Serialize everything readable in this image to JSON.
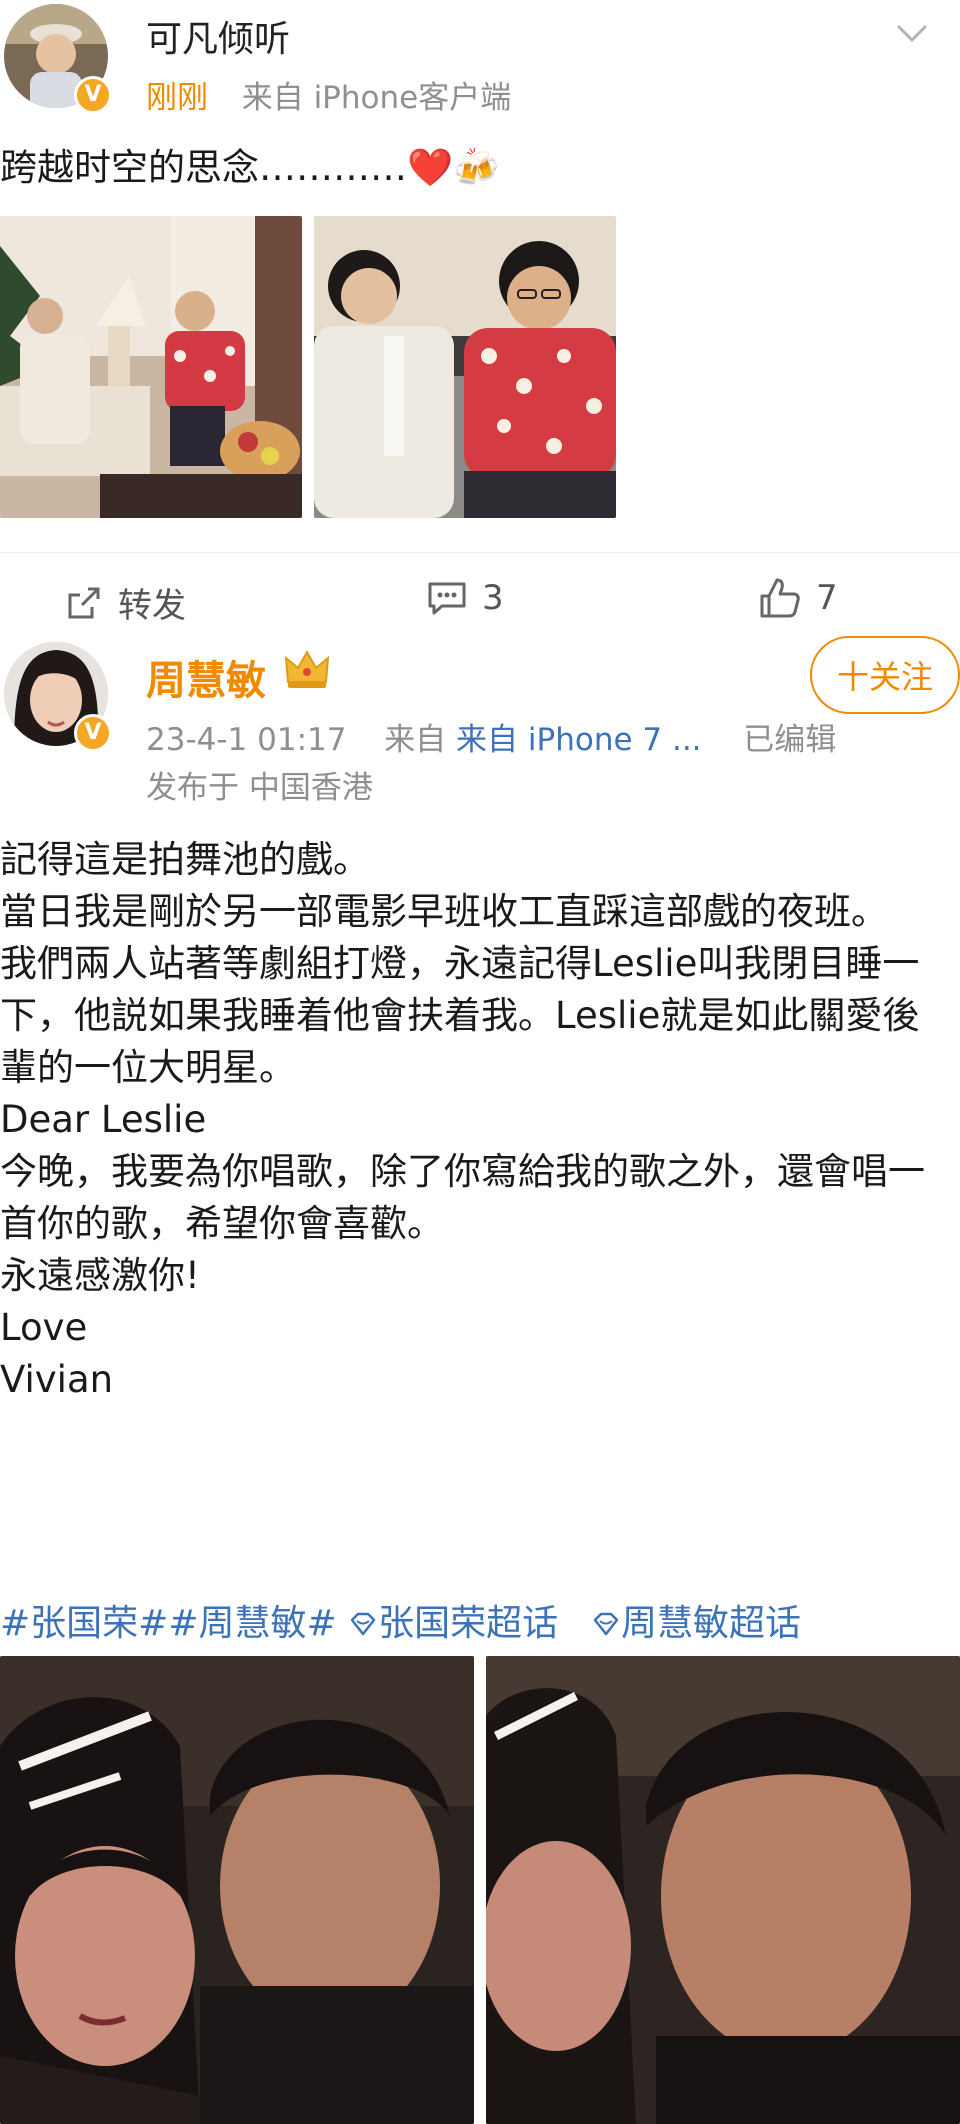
{
  "post1": {
    "username": "可凡倾听",
    "time": "刚刚",
    "source": "来自 iPhone客户端",
    "text": "跨越时空的思念…………",
    "emoji": "❤️🍻",
    "actions": {
      "repost_label": "转发",
      "comment_count": "3",
      "like_count": "7"
    }
  },
  "post2": {
    "username": "周慧敏",
    "crown_icon": "crown-icon",
    "follow_label": "十关注",
    "time": "23-4-1 01:17",
    "source": "来自 iPhone 7 ...",
    "edited": "已编辑",
    "location": "发布于 中国香港",
    "paragraphs": [
      "記得這是拍舞池的戲。",
      "當日我是剛於另一部電影早班收工直踩這部戲的夜班。",
      "我們兩人站著等劇組打燈，永遠記得Leslie叫我閉目睡一下，他説如果我睡着他會扶着我。Leslie就是如此關愛後輩的一位大明星。",
      "Dear Leslie",
      "今晚，我要為你唱歌，除了你寫給我的歌之外，還會唱一首你的歌，希望你會喜歡。",
      "永遠感激你!",
      "Love",
      "Vivian"
    ],
    "tags": [
      "#张国荣##周慧敏#",
      "张国荣超话",
      "周慧敏超话"
    ]
  },
  "colors": {
    "accent_orange": "#f08a00",
    "link_blue": "#3c73b8",
    "verified": "#f5a623"
  }
}
